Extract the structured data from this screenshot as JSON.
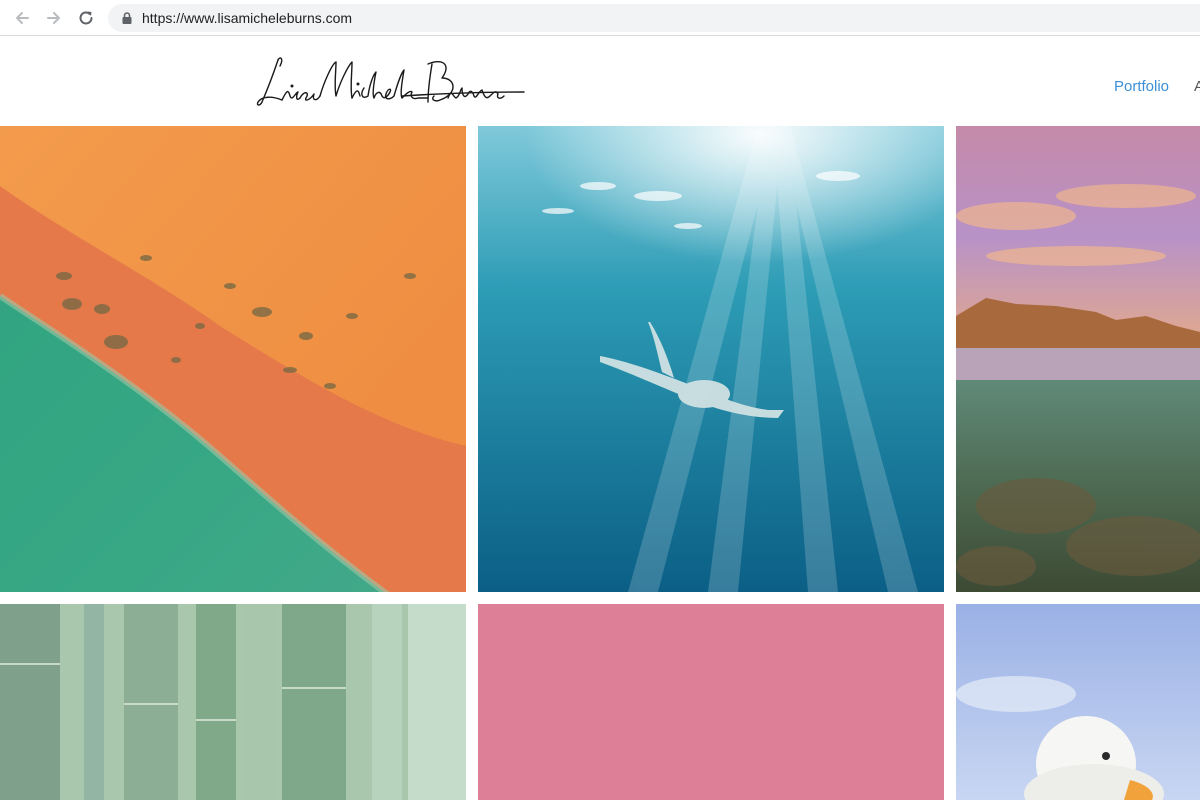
{
  "browser": {
    "url": "https://www.lisamicheleburns.com",
    "icons": [
      "back-arrow-icon",
      "forward-arrow-icon",
      "reload-icon",
      "lock-icon"
    ]
  },
  "site": {
    "logo_text": "Lisa Michele Burns",
    "nav": [
      {
        "label": "Portfolio",
        "active": true
      },
      {
        "label": "A",
        "active": false
      }
    ]
  },
  "gallery": {
    "photos": [
      {
        "subject": "aerial orange sand dune meeting green water"
      },
      {
        "subject": "underwater swimmer under sun rays"
      },
      {
        "subject": "mountain lake split water view at dusk"
      },
      {
        "subject": "green bamboo stalks"
      },
      {
        "subject": "pink background"
      },
      {
        "subject": "white duck against blue sky"
      }
    ]
  },
  "colors": {
    "nav_active": "#3a8fd8",
    "nav_inactive": "#555555",
    "url_text": "#202124"
  }
}
